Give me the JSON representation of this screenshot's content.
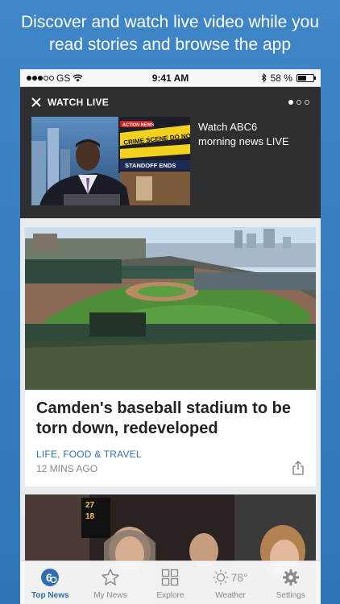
{
  "promo": {
    "line1": "Discover and watch live video while you",
    "line2": "read stories and browse the app"
  },
  "status_bar": {
    "carrier": "GS",
    "time": "9:41 AM",
    "battery": "58 %",
    "battery_level": 0.58
  },
  "live": {
    "title": "WATCH LIVE",
    "description": "Watch ABC6 morning news LIVE",
    "thumb_labels": {
      "action_news": "ACTION NEWS",
      "crime_scene": "CRIME SCENE DO NOT CROSS",
      "standoff": "STANDOFF ENDS"
    }
  },
  "story1": {
    "title": "Camden's baseball stadium to be torn down, redeveloped",
    "category": "LIFE, FOOD & TRAVEL",
    "time": "12 MINS AGO"
  },
  "story2": {
    "score_top": "27",
    "score_bottom": "18"
  },
  "tabs": [
    {
      "label": "Top News",
      "icon": "abc6-logo-icon"
    },
    {
      "label": "My News",
      "icon": "star-icon"
    },
    {
      "label": "Explore",
      "icon": "grid-icon"
    },
    {
      "label": "Weather",
      "icon": "sun-icon",
      "temp": "78°"
    },
    {
      "label": "Settings",
      "icon": "gear-icon"
    }
  ],
  "colors": {
    "accent": "#2f6fb0",
    "background": "#3f86c9",
    "live_panel": "#2d2f33"
  }
}
